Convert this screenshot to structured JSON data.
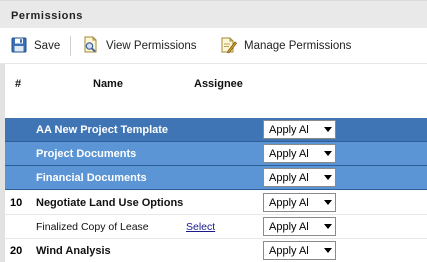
{
  "panel": {
    "title": "Permissions"
  },
  "toolbar": {
    "save_label": "Save",
    "view_label": "View Permissions",
    "manage_label": "Manage Permissions"
  },
  "columns": {
    "num": "#",
    "name": "Name",
    "assignee": "Assignee"
  },
  "rows": [
    {
      "num": "",
      "name": "AA New Project Template",
      "link": "",
      "permission": "Apply Al"
    },
    {
      "num": "",
      "name": "Project Documents",
      "link": "",
      "permission": "Apply Al"
    },
    {
      "num": "",
      "name": "Financial Documents",
      "link": "",
      "permission": "Apply Al"
    },
    {
      "num": "10",
      "name": "Negotiate Land Use Options",
      "link": "",
      "permission": "Apply Al"
    },
    {
      "num": "",
      "name": "Finalized Copy of Lease",
      "link": "Select",
      "permission": "Apply Al"
    },
    {
      "num": "20",
      "name": "Wind Analysis",
      "link": "",
      "permission": "Apply Al"
    }
  ],
  "colors": {
    "header_bg": "#e9e9e9",
    "row_dark": "#3f75b5",
    "row_light": "#5b95d6",
    "link": "#1a1a8c"
  },
  "icons": {
    "save": "floppy-disk-icon",
    "view": "document-view-icon",
    "manage": "document-edit-icon",
    "dropdown": "dropdown-arrow-icon"
  }
}
